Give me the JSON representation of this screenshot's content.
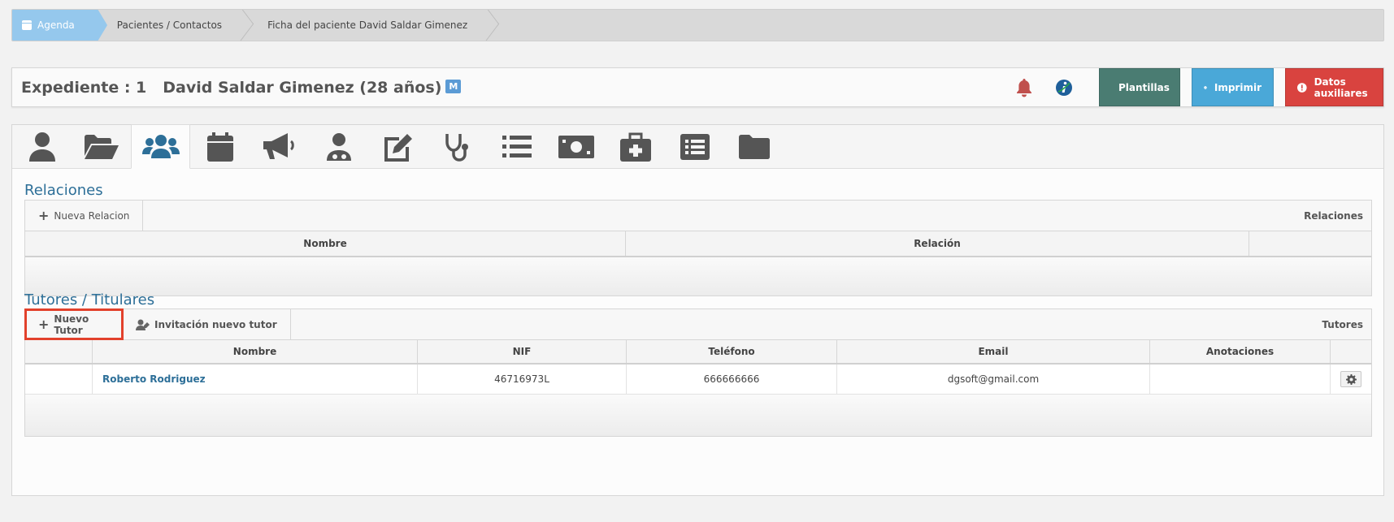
{
  "breadcrumb": {
    "items": [
      "Agenda",
      "Pacientes / Contactos",
      "Ficha del paciente David Saldar Gimenez"
    ]
  },
  "header": {
    "expediente": "Expediente : 1",
    "patient": "David Saldar Gimenez (28 años)",
    "badge": "M",
    "buttons": {
      "plantillas": "Plantillas",
      "imprimir": "Imprimir",
      "datos": "Datos auxiliares"
    }
  },
  "tabs": [
    "user-icon",
    "folder-open-icon",
    "users-icon",
    "calendar-icon",
    "megaphone-icon",
    "doctor-icon",
    "edit-icon",
    "stethoscope-icon",
    "list-icon",
    "money-icon",
    "medkit-icon",
    "list-alt-icon",
    "folder-icon"
  ],
  "relaciones": {
    "title": "Relaciones",
    "new_button": "Nueva Relacion",
    "toolbar_label": "Relaciones",
    "columns": [
      "Nombre",
      "Relación"
    ]
  },
  "tutores": {
    "title": "Tutores / Titulares",
    "new_button": "Nuevo Tutor",
    "invite_button": "Invitación nuevo tutor",
    "toolbar_label": "Tutores",
    "columns": [
      "",
      "Nombre",
      "NIF",
      "Teléfono",
      "Email",
      "Anotaciones",
      ""
    ],
    "rows": [
      {
        "nombre": "Roberto Rodriguez",
        "nif": "46716973L",
        "telefono": "666666666",
        "email": "dgsoft@gmail.com",
        "anotaciones": ""
      }
    ]
  },
  "colors": {
    "accent": "#2d6f98",
    "agenda": "#95c8ed",
    "plantillas": "#4a7c72",
    "imprimir": "#4aa8d8",
    "datos": "#d9433f",
    "highlight": "#e2412c"
  }
}
